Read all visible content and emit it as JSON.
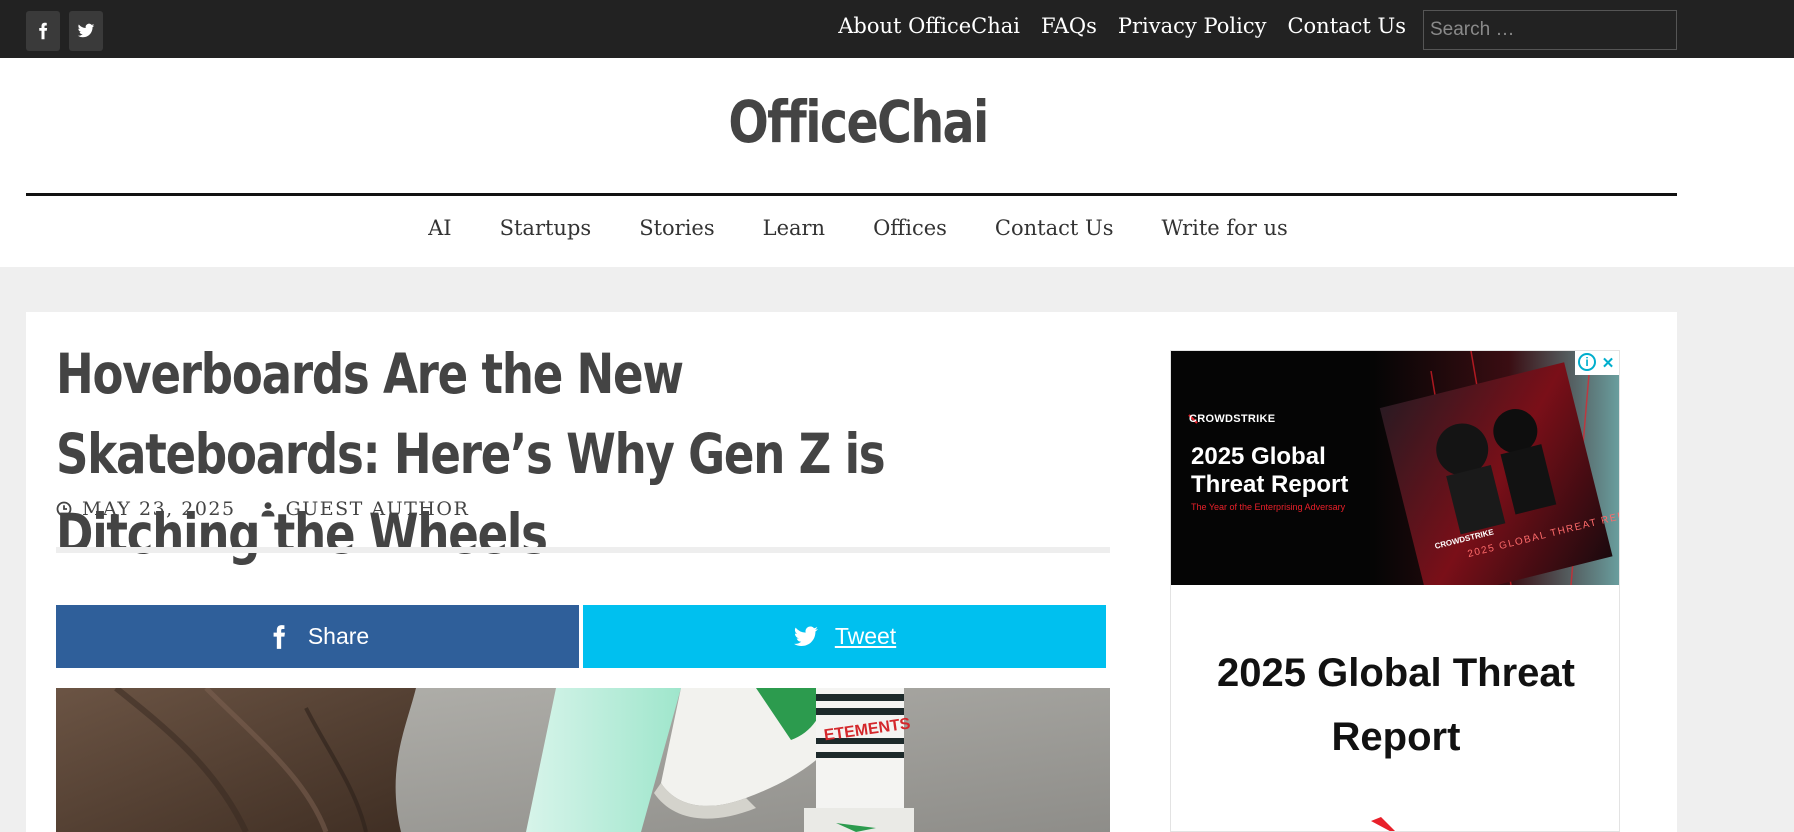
{
  "topbar": {
    "social": [
      {
        "icon": "facebook-icon"
      },
      {
        "icon": "twitter-icon"
      }
    ],
    "links": [
      "About OfficeChai",
      "FAQs",
      "Privacy Policy",
      "Contact Us"
    ],
    "search_placeholder": "Search …"
  },
  "header": {
    "site_title": "OfficeChai",
    "nav": [
      "AI",
      "Startups",
      "Stories",
      "Learn",
      "Offices",
      "Contact Us",
      "Write for us"
    ]
  },
  "article": {
    "title": "Hoverboards Are the New Skateboards: Here’s Why Gen Z is Ditching the Wheels",
    "date": "MAY 23, 2025",
    "author": "GUEST AUTHOR",
    "share_label": "Share",
    "tweet_label": "Tweet",
    "sock_text": "ETEMENTS"
  },
  "ad": {
    "brand": "CROWDSTRIKE",
    "banner_title": "2025 Global Threat Report",
    "banner_tagline": "The Year of the Enterprising Adversary",
    "cover_brand": "CROWDSTRIKE",
    "cover_title": "2025 GLOBAL THREAT REPORT",
    "headline": "2025 Global Threat Report"
  },
  "colors": {
    "topbar": "#222222",
    "facebook": "#2f5f9a",
    "twitter": "#00c0ef",
    "title_text": "#444444"
  }
}
